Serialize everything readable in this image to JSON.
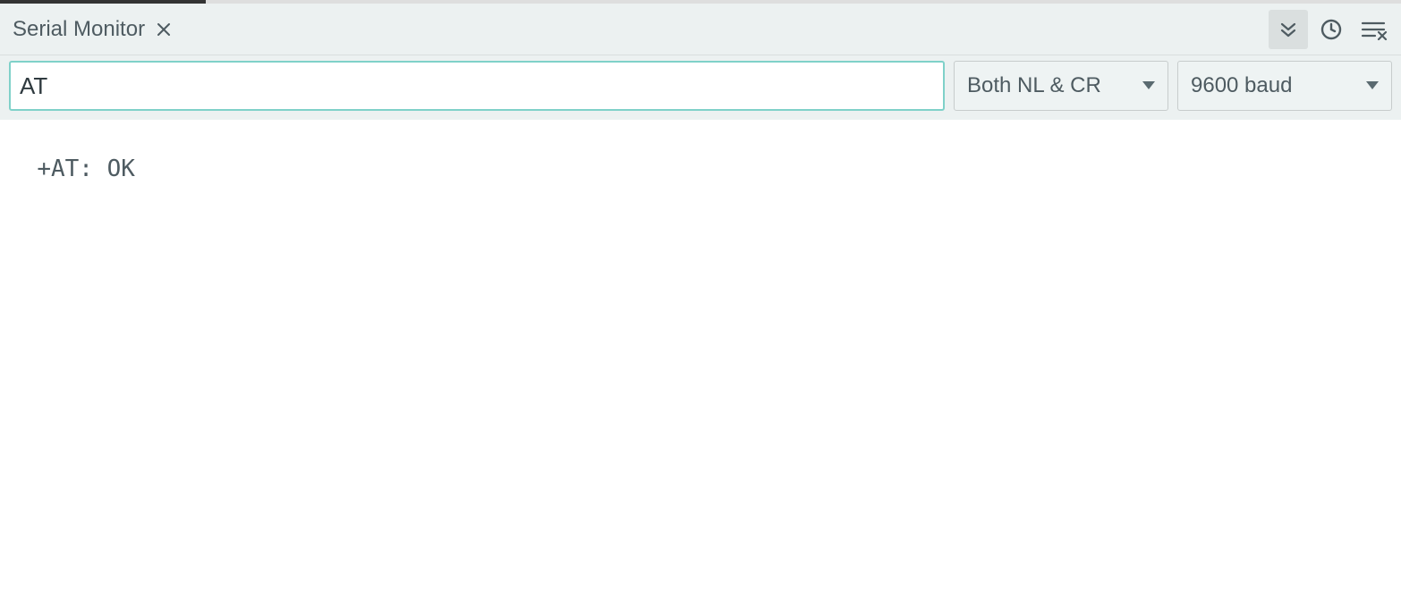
{
  "header": {
    "tab_title": "Serial Monitor"
  },
  "toolbar": {
    "command_input_value": "AT",
    "line_ending_selected": "Both NL & CR",
    "baud_selected": "9600 baud"
  },
  "output": {
    "lines": "+AT: OK"
  },
  "icons": {
    "close": "close-icon",
    "scroll_down": "double-chevron-down-icon",
    "timestamp": "clock-icon",
    "clear": "clear-lines-icon"
  }
}
